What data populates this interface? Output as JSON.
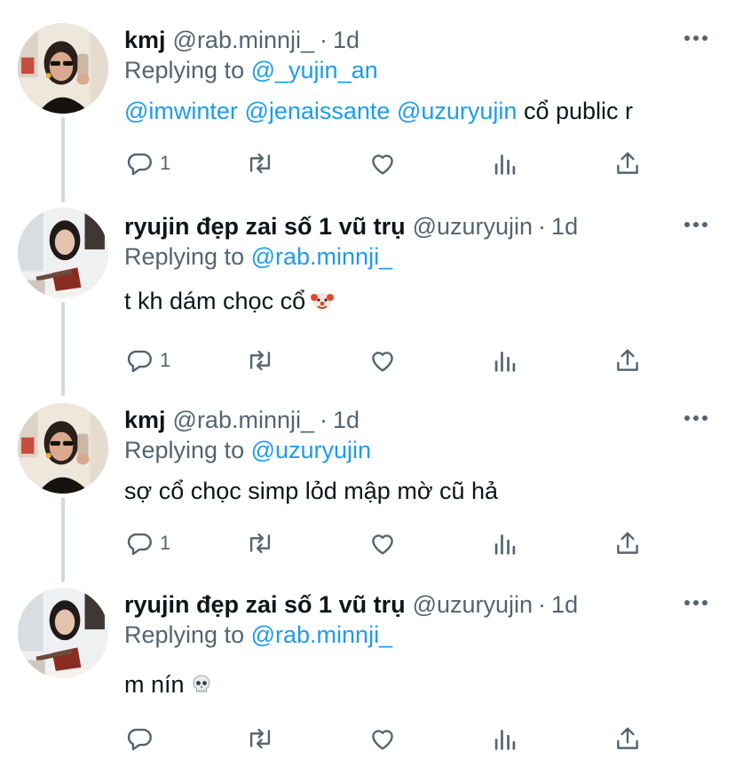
{
  "thread": {
    "tweets": [
      {
        "avatar": "avatar-woman-sunglasses",
        "name": "kmj",
        "handle": "@rab.minnji_",
        "dot": "·",
        "time": "1d",
        "replying_prefix": "Replying to",
        "replying_to": "@_yujin_an",
        "mentions": [
          "@imwinter",
          "@jenaissante",
          "@uzuryujin"
        ],
        "text": "cổ public r",
        "emoji": "",
        "reply_count": "1"
      },
      {
        "avatar": "avatar-guitar-player",
        "name": "ryujin đẹp zai số 1 vũ trụ",
        "handle": "@uzuryujin",
        "dot": "·",
        "time": "1d",
        "replying_prefix": "Replying to",
        "replying_to": "@rab.minnji_",
        "mentions": [],
        "text": "t kh dám chọc cổ",
        "emoji": "clown-face-emoji",
        "reply_count": "1"
      },
      {
        "avatar": "avatar-woman-sunglasses",
        "name": "kmj",
        "handle": "@rab.minnji_",
        "dot": "·",
        "time": "1d",
        "replying_prefix": "Replying to",
        "replying_to": "@uzuryujin",
        "mentions": [],
        "text": "sợ cổ chọc simp lỏd mập mờ cũ hả",
        "emoji": "",
        "reply_count": "1"
      },
      {
        "avatar": "avatar-guitar-player",
        "name": "ryujin đẹp zai số 1 vũ trụ",
        "handle": "@uzuryujin",
        "dot": "·",
        "time": "1d",
        "replying_prefix": "Replying to",
        "replying_to": "@rab.minnji_",
        "mentions": [],
        "text": "m nín",
        "emoji": "skull-emoji",
        "reply_count": ""
      }
    ]
  },
  "icons": {
    "reply": "reply-icon",
    "retweet": "retweet-icon",
    "like": "like-icon",
    "views": "views-icon",
    "share": "share-icon",
    "more": "more-icon"
  },
  "colors": {
    "link": "#1d9bf0",
    "secondary_text": "#536471",
    "primary_text": "#0f1419",
    "thread_line": "#cfd9de"
  }
}
